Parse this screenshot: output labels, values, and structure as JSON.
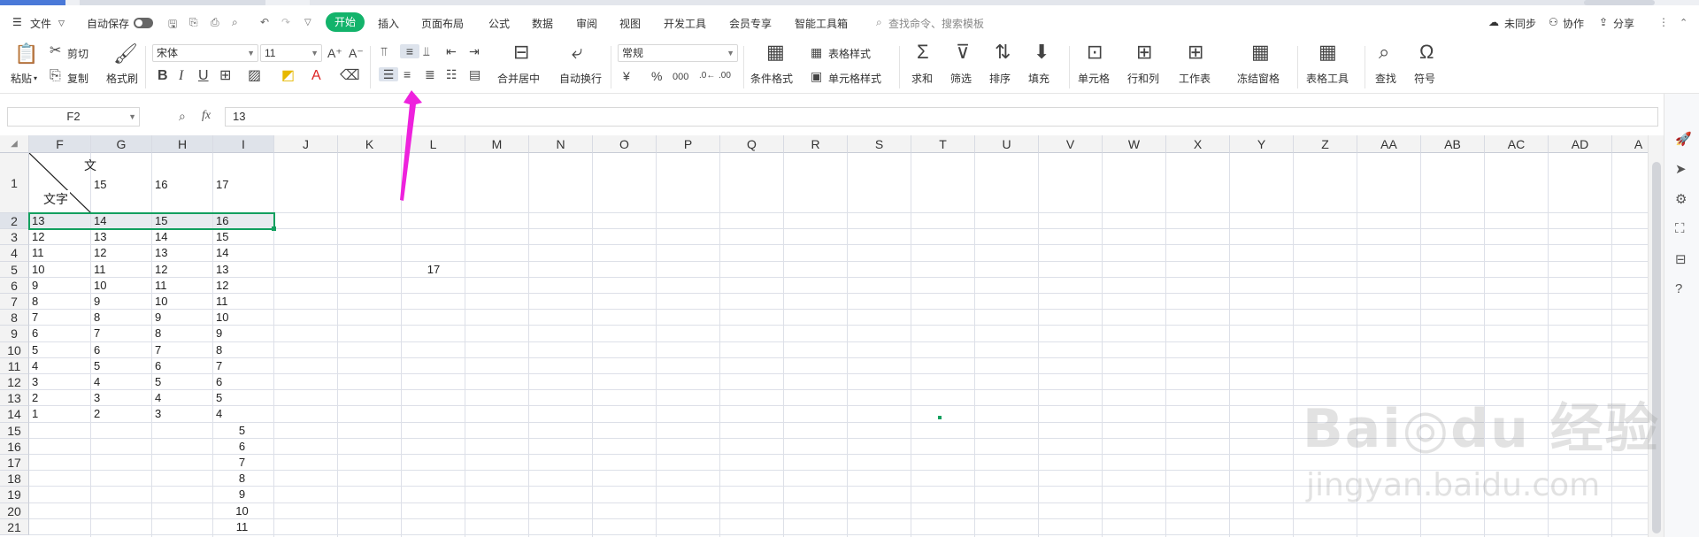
{
  "window": {
    "menu_file": "文件",
    "autosave": "自动保存",
    "tabs": [
      "开始",
      "插入",
      "页面布局",
      "公式",
      "数据",
      "审阅",
      "视图",
      "开发工具",
      "会员专享",
      "智能工具箱"
    ],
    "search_placeholder": "查找命令、搜索模板",
    "right_actions": [
      "未同步",
      "协作",
      "分享"
    ]
  },
  "ribbon": {
    "paste": "粘贴",
    "cut": "剪切",
    "copy": "复制",
    "format_painter": "格式刷",
    "font_name": "宋体",
    "font_size": "11",
    "merge_center": "合并居中",
    "wrap_text": "自动换行",
    "number_format": "常规",
    "cond_format": "条件格式",
    "table_style": "表格样式",
    "cell_style": "单元格样式",
    "sum": "求和",
    "filter": "筛选",
    "sort": "排序",
    "fill": "填充",
    "cell": "单元格",
    "row_col": "行和列",
    "worksheet": "工作表",
    "freeze": "冻结窗格",
    "table_tools": "表格工具",
    "find": "查找",
    "symbol": "符号",
    "percent": "%",
    "thousands": "000"
  },
  "formula_bar": {
    "name_box": "F2",
    "fx": "fx",
    "value": "13"
  },
  "grid": {
    "columns": [
      "F",
      "G",
      "H",
      "I",
      "J",
      "K",
      "L",
      "M",
      "N",
      "O",
      "P",
      "Q",
      "R",
      "S",
      "T",
      "U",
      "V",
      "W",
      "X",
      "Y",
      "Z",
      "AA",
      "AB",
      "AC",
      "AD",
      "A"
    ],
    "rows": [
      "1",
      "2",
      "3",
      "4",
      "5",
      "6",
      "7",
      "8",
      "9",
      "10",
      "11",
      "12",
      "13",
      "14",
      "15",
      "16",
      "17",
      "18",
      "19",
      "20",
      "21"
    ],
    "header_cell_top": "文",
    "header_cell_bottom": "文字",
    "row1": [
      "15",
      "16",
      "17"
    ],
    "body": [
      [
        "13",
        "14",
        "15",
        "16"
      ],
      [
        "12",
        "13",
        "14",
        "15"
      ],
      [
        "11",
        "12",
        "13",
        "14"
      ],
      [
        "10",
        "11",
        "12",
        "13"
      ],
      [
        "9",
        "10",
        "11",
        "12"
      ],
      [
        "8",
        "9",
        "10",
        "11"
      ],
      [
        "7",
        "8",
        "9",
        "10"
      ],
      [
        "6",
        "7",
        "8",
        "9"
      ],
      [
        "5",
        "6",
        "7",
        "8"
      ],
      [
        "4",
        "5",
        "6",
        "7"
      ],
      [
        "3",
        "4",
        "5",
        "6"
      ],
      [
        "2",
        "3",
        "4",
        "5"
      ],
      [
        "1",
        "2",
        "3",
        "4"
      ]
    ],
    "col_i_lower": [
      "5",
      "6",
      "7",
      "8",
      "9",
      "10",
      "11"
    ],
    "l5_value": "17"
  },
  "colors": {
    "accent": "#13b36b",
    "arrow": "#ee22dd",
    "selection": "#13a05f"
  }
}
